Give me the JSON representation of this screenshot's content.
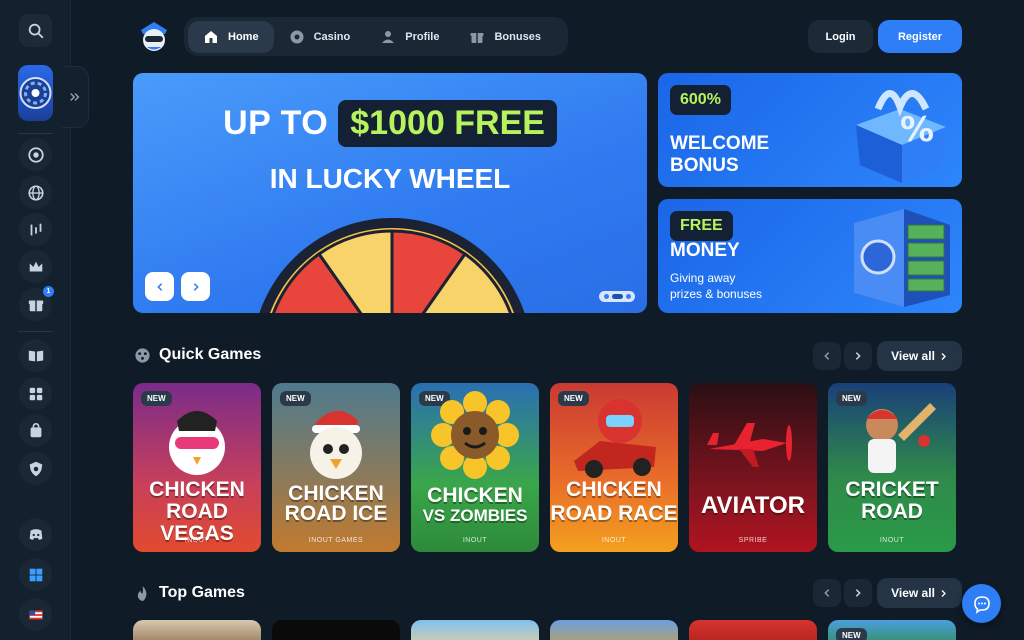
{
  "nav": {
    "items": [
      {
        "label": "Home",
        "icon": "home-icon"
      },
      {
        "label": "Casino",
        "icon": "chip-icon"
      },
      {
        "label": "Profile",
        "icon": "user-icon"
      },
      {
        "label": "Bonuses",
        "icon": "gift-icon"
      }
    ],
    "active": "Home"
  },
  "auth": {
    "login": "Login",
    "register": "Register"
  },
  "sidebar": {
    "icons": [
      "search-icon",
      "expand-chevrons-icon",
      "chip-icon",
      "globe-icon",
      "chart-icon",
      "crown-icon",
      "gift-icon",
      "book-icon",
      "puzzle-icon",
      "bag-icon",
      "shield-icon",
      "discord-icon",
      "windows-icon",
      "us-flag-icon"
    ],
    "gift_badge": "1"
  },
  "hero": {
    "line1_prefix": "UP TO",
    "line1_amount": "$1000 FREE",
    "line2": "IN LUCKY WHEEL"
  },
  "promos": [
    {
      "tag": "600%",
      "title_line1": "WELCOME",
      "title_line2": "BONUS"
    },
    {
      "tag": "FREE",
      "title_line1": "MONEY",
      "sub_line1": "Giving away",
      "sub_line2": "prizes & bonuses"
    }
  ],
  "quick_games": {
    "title": "Quick Games",
    "view_all": "View all",
    "games": [
      {
        "line1": "CHICKEN",
        "line2": "ROAD VEGAS",
        "provider": "INOUT",
        "new_label": "NEW",
        "is_new": true
      },
      {
        "line1": "CHICKEN",
        "line2": "ROAD ICE",
        "provider": "INOUT GAMES",
        "new_label": "NEW",
        "is_new": true
      },
      {
        "line1": "CHICKEN",
        "line2": "VS ZOMBIES",
        "provider": "INOUT",
        "new_label": "NEW",
        "is_new": true
      },
      {
        "line1": "CHICKEN",
        "line2": "ROAD RACE",
        "provider": "INOUT",
        "new_label": "NEW",
        "is_new": true
      },
      {
        "line1": "AVIATOR",
        "line2": "",
        "provider": "SPRIBE",
        "new_label": "",
        "is_new": false
      },
      {
        "line1": "CRICKET",
        "line2": "ROAD",
        "provider": "INOUT",
        "new_label": "NEW",
        "is_new": true
      }
    ]
  },
  "top_games": {
    "title": "Top Games",
    "view_all": "View all",
    "new_label": "NEW"
  },
  "colors": {
    "accent": "#2e7ef5",
    "lime": "#b6f35d",
    "bg": "#0f1b27"
  }
}
